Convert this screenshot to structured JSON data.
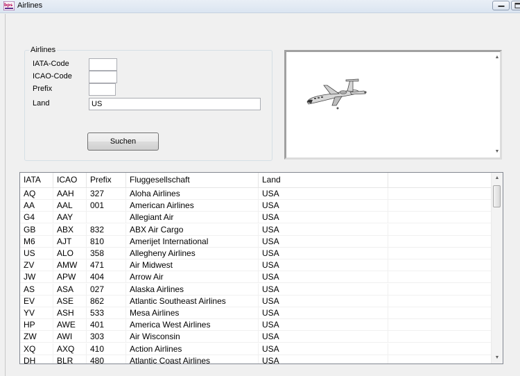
{
  "window": {
    "title": "Airlines"
  },
  "search": {
    "group_label": "Airlines",
    "iata_label": "IATA-Code",
    "iata_value": "",
    "icao_label": "ICAO-Code",
    "icao_value": "",
    "prefix_label": "Prefix",
    "prefix_value": "",
    "country_label": "Land",
    "country_value": "US",
    "search_button": "Suchen"
  },
  "picture": {
    "icon": "airplane-image"
  },
  "grid": {
    "columns": [
      "IATA",
      "ICAO",
      "Prefix",
      "Fluggesellschaft",
      "Land",
      ""
    ],
    "rows": [
      [
        "AQ",
        "AAH",
        "327",
        "Aloha Airlines",
        "USA"
      ],
      [
        "AA",
        "AAL",
        "001",
        "American Airlines",
        "USA"
      ],
      [
        "G4",
        "AAY",
        "",
        "Allegiant Air",
        "USA"
      ],
      [
        "GB",
        "ABX",
        "832",
        "ABX Air Cargo",
        "USA"
      ],
      [
        "M6",
        "AJT",
        "810",
        "Amerijet International",
        "USA"
      ],
      [
        "US",
        "ALO",
        "358",
        "Allegheny Airlines",
        "USA"
      ],
      [
        "ZV",
        "AMW",
        "471",
        "Air Midwest",
        "USA"
      ],
      [
        "JW",
        "APW",
        "404",
        "Arrow Air",
        "USA"
      ],
      [
        "AS",
        "ASA",
        "027",
        "Alaska Airlines",
        "USA"
      ],
      [
        "EV",
        "ASE",
        "862",
        "Atlantic Southeast Airlines",
        "USA"
      ],
      [
        "YV",
        "ASH",
        "533",
        "Mesa Airlines",
        "USA"
      ],
      [
        "HP",
        "AWE",
        "401",
        "America West Airlines",
        "USA"
      ],
      [
        "ZW",
        "AWI",
        "303",
        "Air Wisconsin",
        "USA"
      ],
      [
        "XQ",
        "AXQ",
        "410",
        "Action Airlines",
        "USA"
      ],
      [
        "DH",
        "BLR",
        "480",
        "Atlantic Coast Airlines",
        "USA"
      ]
    ]
  }
}
